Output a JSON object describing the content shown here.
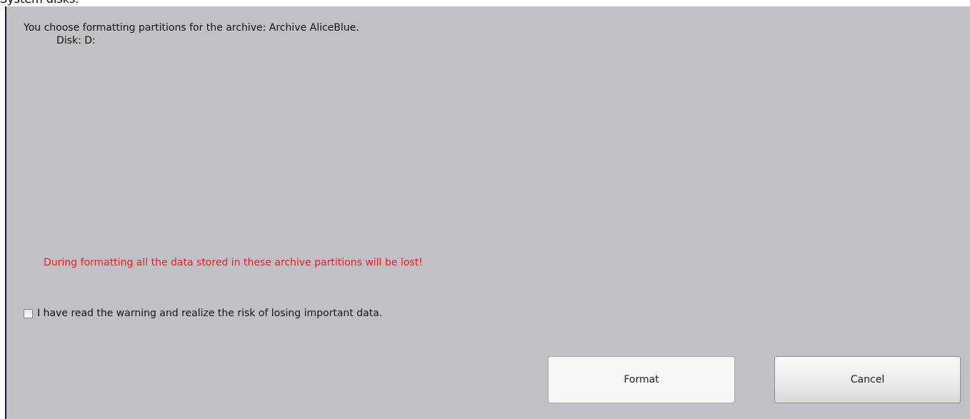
{
  "caption": "System disks.",
  "dialog": {
    "info_line_1": "You choose formatting partitions for the archive: Archive AliceBlue.",
    "info_line_2": "Disk: D:",
    "warning": "During formatting all the data stored in these archive partitions will be lost!",
    "confirm_checkbox_label": "I have read the warning and realize the risk of losing important data.",
    "confirm_checked": false,
    "format_button": "Format",
    "cancel_button": "Cancel"
  },
  "colors": {
    "dialog_background": "#c1c0c5",
    "warning_text": "#ee1c25"
  },
  "icons": {
    "checkbox": "checkbox-unchecked-icon"
  }
}
